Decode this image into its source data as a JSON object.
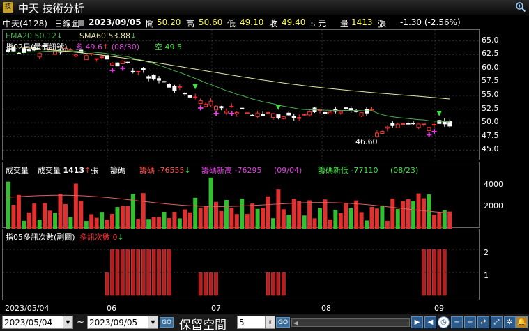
{
  "app": {
    "title": "中天 技術分析",
    "logo_glyph": "技"
  },
  "quote": {
    "name": "中天(4128)",
    "period": "日線圖",
    "date": "2023/09/05",
    "open_label": "開",
    "open": "50.20",
    "high_label": "高",
    "high": "50.60",
    "low_label": "低",
    "low": "49.10",
    "close_label": "收",
    "close": "49.40",
    "unit": "s 元",
    "vol_label": "量",
    "vol": "1413",
    "vol_unit": "張",
    "change": "-1.30 (-2.56%)"
  },
  "price_panel": {
    "ema_label": "EMA20 50.12",
    "ema_arrow": "↓",
    "sma_label": "SMA60 53.88",
    "sma_arrow": "↓",
    "signal_label": "指02日(量價訊號)",
    "long_label": "多 49.6",
    "long_arrow": "↑",
    "long_date": "(08/30)",
    "short_label": "空 49.5",
    "low_annotation": "46.60",
    "yticks": [
      "65.0",
      "62.5",
      "60.0",
      "57.5",
      "55.0",
      "52.5",
      "50.0",
      "47.5",
      "45.0"
    ]
  },
  "volume_panel": {
    "title": "成交量",
    "vol_label": "成交量",
    "vol": "1413",
    "vol_arrow": "↑",
    "vol_unit": "張",
    "chips_label": "籌碼",
    "chips_name": "籌碼",
    "chips_value": "-76555",
    "chips_arrow": "↓",
    "high_label": "籌碼新高",
    "high_value": "-76295",
    "high_date": "(09/04)",
    "low_label": "籌碼新低",
    "low_value": "-77110",
    "low_date": "(08/23)",
    "yticks": [
      "4000",
      "2000"
    ]
  },
  "signal_panel": {
    "title": "指05多訊次數(副圖)",
    "count_label": "多訊次數",
    "count_value": "0",
    "count_arrow": "↓",
    "yticks": [
      "2",
      "1"
    ]
  },
  "x_axis": {
    "labels": [
      "2023/05/04",
      "06",
      "07",
      "08",
      "09"
    ]
  },
  "bottom": {
    "start_date": "2023/05/04",
    "tilde": "~",
    "end_date": "2023/09/05",
    "go": "GO",
    "reserve_label": "保留空間",
    "reserve_value": "5",
    "go2": "GO"
  },
  "colors": {
    "up": "#ff3030",
    "down": "#ffffff",
    "ema": "#4caf50",
    "sma": "#e6e6a0",
    "vol_up": "#e03030",
    "vol_down": "#30c030"
  },
  "chart_data": {
    "type": "candlestick",
    "series": [
      {
        "name": "EMA20",
        "value": 50.12
      },
      {
        "name": "SMA60",
        "value": 53.88
      }
    ],
    "last": {
      "open": 50.2,
      "high": 50.6,
      "low": 49.1,
      "close": 49.4,
      "volume": 1413
    },
    "ylim": [
      43.0,
      67.0
    ],
    "period_low": 46.6
  }
}
